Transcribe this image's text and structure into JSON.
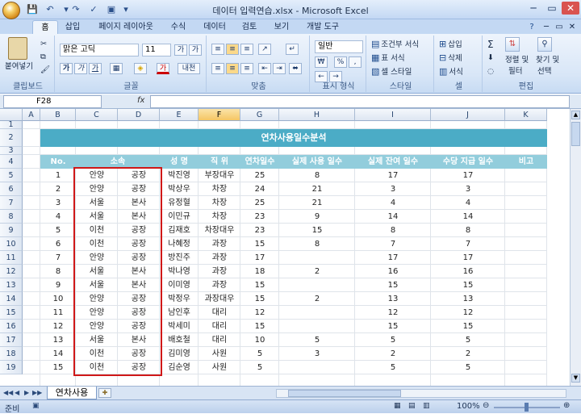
{
  "window": {
    "title": "데이터 입력연습.xlsx - Microsoft Excel"
  },
  "tabs": [
    "홈",
    "삽입",
    "페이지 레이아웃",
    "수식",
    "데이터",
    "검토",
    "보기",
    "개발 도구"
  ],
  "ribbon": {
    "clipboard": {
      "label": "클립보드",
      "paste": "붙여넣기"
    },
    "font": {
      "label": "글꼴",
      "name": "맑은 고딕",
      "size": "11",
      "bold": "가",
      "italic": "가",
      "underline": "가",
      "inc": "가",
      "dec": "가",
      "font_color": "가",
      "phonetic": "내천"
    },
    "alignment": {
      "label": "맞춤"
    },
    "number": {
      "label": "표시 형식",
      "format": "일반",
      "currency": "₩",
      "percent": "%",
      "comma": ","
    },
    "styles": {
      "label": "스타일",
      "conditional": "조건부 서식",
      "table": "표 서식",
      "cell_style": "셀 스타일"
    },
    "cells": {
      "label": "셀",
      "insert": "삽입",
      "delete": "삭제",
      "format": "서식"
    },
    "editing": {
      "label": "편집",
      "sort": "정렬 및",
      "filter": "필터",
      "find": "찾기 및",
      "select": "선택"
    }
  },
  "formula_bar": {
    "name_box": "F28",
    "fx": "fx",
    "value": ""
  },
  "columns": [
    "A",
    "B",
    "C",
    "D",
    "E",
    "F",
    "G",
    "H",
    "I",
    "J",
    "K"
  ],
  "rows": [
    "1",
    "2",
    "3",
    "4",
    "5",
    "6",
    "7",
    "8",
    "9",
    "10",
    "11",
    "12",
    "13",
    "14",
    "15",
    "16",
    "17",
    "18",
    "19"
  ],
  "table": {
    "title": "연차사용일수분석",
    "headers": [
      "No.",
      "소속",
      "성 명",
      "직 위",
      "연차일수",
      "실제 사용 일수",
      "실제 잔여 일수",
      "수당 지급 일수",
      "비고"
    ],
    "data": [
      [
        "1",
        "안양",
        "공장",
        "박진영",
        "부장대우",
        "25",
        "8",
        "17",
        "17",
        ""
      ],
      [
        "2",
        "안양",
        "공장",
        "박상우",
        "차장",
        "24",
        "21",
        "3",
        "3",
        ""
      ],
      [
        "3",
        "서울",
        "본사",
        "유정혈",
        "차장",
        "25",
        "21",
        "4",
        "4",
        ""
      ],
      [
        "4",
        "서울",
        "본사",
        "이민규",
        "차장",
        "23",
        "9",
        "14",
        "14",
        ""
      ],
      [
        "5",
        "이천",
        "공장",
        "김재호",
        "차장대우",
        "23",
        "15",
        "8",
        "8",
        ""
      ],
      [
        "6",
        "이천",
        "공장",
        "나혜정",
        "과장",
        "15",
        "8",
        "7",
        "7",
        ""
      ],
      [
        "7",
        "안양",
        "공장",
        "방진주",
        "과장",
        "17",
        "",
        "17",
        "17",
        ""
      ],
      [
        "8",
        "서울",
        "본사",
        "박나영",
        "과장",
        "18",
        "2",
        "16",
        "16",
        ""
      ],
      [
        "9",
        "서울",
        "본사",
        "이미영",
        "과장",
        "15",
        "",
        "15",
        "15",
        ""
      ],
      [
        "10",
        "안양",
        "공장",
        "박정우",
        "과장대우",
        "15",
        "2",
        "13",
        "13",
        ""
      ],
      [
        "11",
        "안양",
        "공장",
        "남인후",
        "대리",
        "12",
        "",
        "12",
        "12",
        ""
      ],
      [
        "12",
        "안양",
        "공장",
        "박세미",
        "대리",
        "15",
        "",
        "15",
        "15",
        ""
      ],
      [
        "13",
        "서울",
        "본사",
        "배호철",
        "대리",
        "10",
        "5",
        "5",
        "5",
        ""
      ],
      [
        "14",
        "이천",
        "공장",
        "김미영",
        "사원",
        "5",
        "3",
        "2",
        "2",
        ""
      ],
      [
        "15",
        "이천",
        "공장",
        "김순영",
        "사원",
        "5",
        "",
        "5",
        "5",
        ""
      ]
    ]
  },
  "sheet_tab": "연차사용",
  "status": {
    "ready": "준비",
    "zoom": "100%"
  },
  "colors": {
    "title_bar": "#4bacc6",
    "header_row": "#92cddc",
    "highlight": "#d01818"
  }
}
